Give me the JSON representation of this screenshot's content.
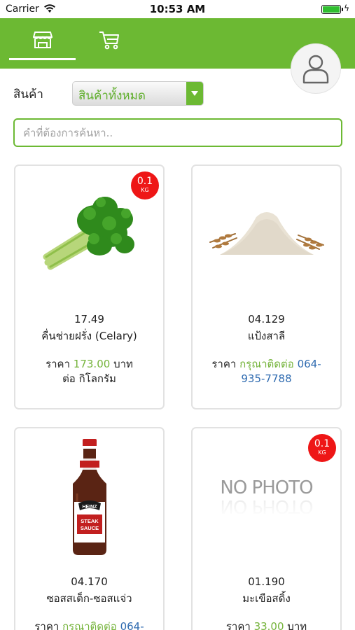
{
  "status_bar": {
    "carrier": "Carrier",
    "time": "10:53 AM",
    "battery_level": 1.0
  },
  "header": {
    "tabs": [
      {
        "icon": "store-icon",
        "active": true
      },
      {
        "icon": "cart-icon",
        "active": false
      }
    ],
    "avatar_icon": "user-icon",
    "brand_color": "#6cb933"
  },
  "filter": {
    "label": "สินค้า",
    "selected_category": "สินค้าทั้งหมด"
  },
  "search": {
    "placeholder": "คำที่ต้องการค้นหา..",
    "value": ""
  },
  "products": [
    {
      "badge_qty": "0.1",
      "badge_unit": "KG",
      "image": "celery",
      "code": "17.49",
      "name": "คื่นช่ายฝรั่ง (Celary)",
      "price_prefix": "ราคา",
      "price_value": "173.00",
      "price_suffix": "บาท",
      "unit_text": "ต่อ กิโลกรัม"
    },
    {
      "image": "flour",
      "code": "04.129",
      "name": "แป้งสาลี",
      "price_prefix": "ราคา",
      "contact_text": "กรุณาติดต่อ",
      "contact_phone_a": "064-",
      "contact_phone_b": "935-7788"
    },
    {
      "image": "steak-sauce-bottle",
      "code": "04.170",
      "name": "ซอสสเต็ก-ซอสแจ่ว",
      "price_prefix": "ราคา",
      "contact_text": "กรุณาติดต่อ",
      "contact_phone_a": "064-"
    },
    {
      "badge_qty": "0.1",
      "badge_unit": "KG",
      "image": "no-photo",
      "no_photo_text": "NO PHOTO",
      "code": "01.190",
      "name": "มะเขือสดิ้ง",
      "price_prefix": "ราคา",
      "price_value": "33.00",
      "price_suffix": "บาท"
    }
  ]
}
